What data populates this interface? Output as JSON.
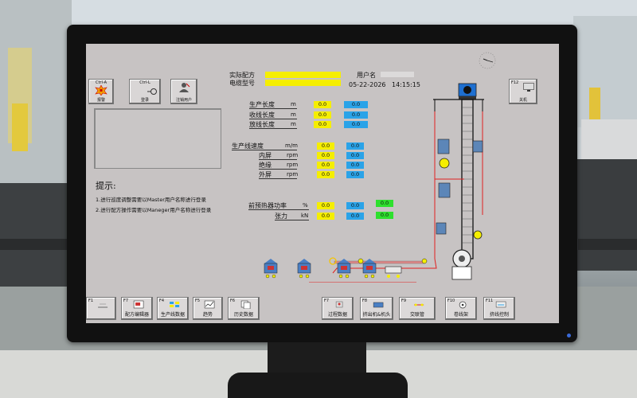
{
  "header": {
    "recipe_label": "实际配方",
    "cable_label": "电缆型号",
    "user_label": "用户名",
    "date": "05-22-2026",
    "time": "14:15:15"
  },
  "top_buttons": [
    {
      "key": "Ctrl-A",
      "label": "报警"
    },
    {
      "key": "Ctrl-L",
      "label": "登录"
    },
    {
      "key": "",
      "label": "注销用户"
    }
  ],
  "f12": {
    "key": "F12",
    "label": "关机"
  },
  "lengths": [
    {
      "label": "生产长度",
      "unit": "m",
      "yellow": "0.0",
      "blue": "0.0"
    },
    {
      "label": "收线长度",
      "unit": "m",
      "yellow": "0.0",
      "blue": "0.0"
    },
    {
      "label": "放线长度",
      "unit": "m",
      "yellow": "0.0",
      "blue": "0.0"
    }
  ],
  "speeds": [
    {
      "label": "生产线速度",
      "unit": "m/m",
      "yellow": "0.0",
      "blue": "0.0"
    },
    {
      "label": "内屏",
      "unit": "rpm",
      "yellow": "0.0",
      "blue": "0.0"
    },
    {
      "label": "绝缘",
      "unit": "rpm",
      "yellow": "0.0",
      "blue": "0.0"
    },
    {
      "label": "外屏",
      "unit": "rpm",
      "yellow": "0.0",
      "blue": "0.0"
    }
  ],
  "heater": {
    "label": "前预热器功率",
    "unit": "%",
    "yellow": "0.0",
    "blue": "0.0",
    "green": "0.0"
  },
  "tension": {
    "label": "张力",
    "unit": "kN",
    "yellow": "0.0",
    "blue": "0.0",
    "green": "0.0"
  },
  "hints": {
    "title": "提示:",
    "line1": "1.进行巡度调整需要以Master用户名称进行登录",
    "line2": "2.进行配方操作需要以Maneger用户名称进行登录"
  },
  "fkeys": [
    {
      "key": "F1",
      "label": ""
    },
    {
      "key": "F7",
      "label": "配方编辑器"
    },
    {
      "key": "F4",
      "label": "生产线数据"
    },
    {
      "key": "F5",
      "label": "趋势"
    },
    {
      "key": "F6",
      "label": "历史数据"
    },
    {
      "key": "F7",
      "label": "过程数据"
    },
    {
      "key": "F8",
      "label": "挤出机&机头"
    },
    {
      "key": "F9",
      "label": "交联管"
    },
    {
      "key": "F10",
      "label": "卷线架"
    },
    {
      "key": "F11",
      "label": "挤线控制"
    }
  ],
  "colors": {
    "yellow": "#f5ee00",
    "blue": "#2aa3e8",
    "green": "#2ee02e",
    "panel": "#c7c3c3",
    "red_line": "#e02020"
  }
}
